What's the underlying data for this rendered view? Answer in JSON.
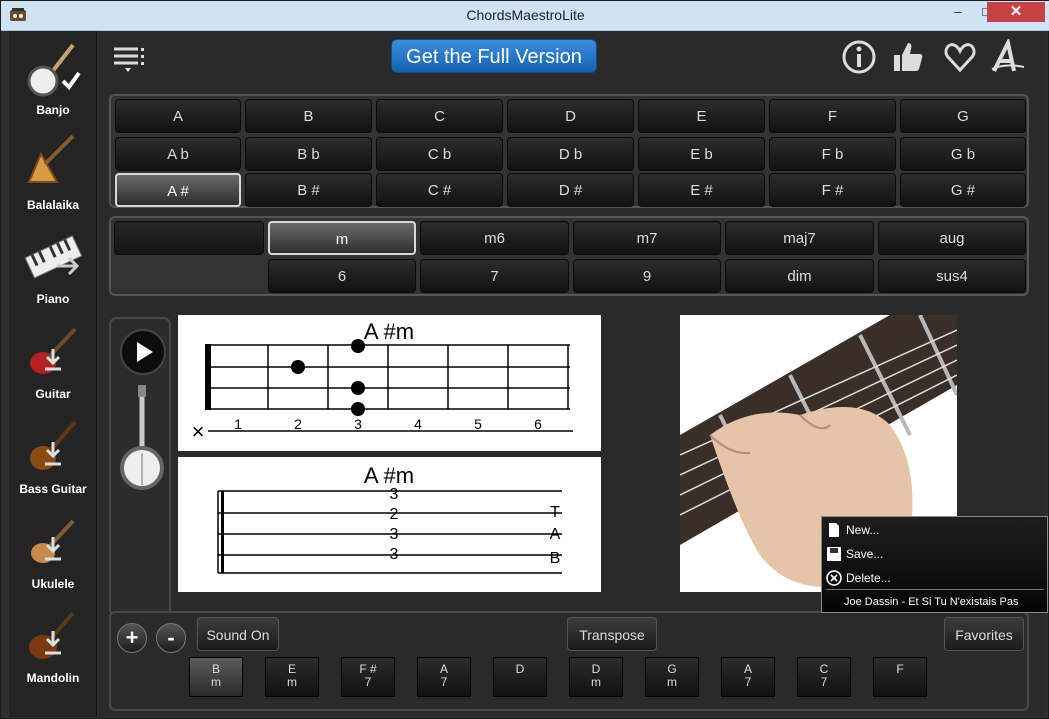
{
  "window": {
    "title": "ChordsMaestroLite"
  },
  "sidebar": {
    "items": [
      {
        "label": "Banjo"
      },
      {
        "label": "Balalaika"
      },
      {
        "label": "Piano"
      },
      {
        "label": "Guitar"
      },
      {
        "label": "Bass Guitar"
      },
      {
        "label": "Ukulele"
      },
      {
        "label": "Mandolin"
      }
    ]
  },
  "header": {
    "full_version": "Get the Full Version"
  },
  "keys": {
    "rows": [
      [
        "A",
        "B",
        "C",
        "D",
        "E",
        "F",
        "G"
      ],
      [
        "A b",
        "B b",
        "C b",
        "D b",
        "E b",
        "F b",
        "G b"
      ],
      [
        "A #",
        "B #",
        "C #",
        "D #",
        "E #",
        "F #",
        "G #"
      ]
    ],
    "selected": "A #"
  },
  "types": {
    "row1": [
      "",
      "m",
      "m6",
      "m7",
      "maj7",
      "aug"
    ],
    "row2": [
      "6",
      "7",
      "9",
      "dim",
      "sus4"
    ],
    "selected": "m"
  },
  "diagram": {
    "chord_name": "A #m",
    "mute": "×",
    "frets": [
      "1",
      "2",
      "3",
      "4",
      "5",
      "6"
    ],
    "dots": [
      {
        "string": 1,
        "fret": 3
      },
      {
        "string": 2,
        "fret": 2
      },
      {
        "string": 3,
        "fret": 3
      },
      {
        "string": 4,
        "fret": 3
      }
    ],
    "tab_numbers": [
      "3",
      "2",
      "3",
      "3"
    ],
    "tab_letters": [
      "T",
      "A",
      "B"
    ]
  },
  "bottom": {
    "sound": "Sound On",
    "transpose": "Transpose",
    "favorites": "Favorites",
    "plus": "+",
    "minus": "-",
    "progression": [
      {
        "n": "B",
        "q": "m"
      },
      {
        "n": "E",
        "q": "m"
      },
      {
        "n": "F #",
        "q": "7"
      },
      {
        "n": "A",
        "q": "7"
      },
      {
        "n": "D",
        "q": ""
      },
      {
        "n": "D",
        "q": "m"
      },
      {
        "n": "G",
        "q": "m"
      },
      {
        "n": "A",
        "q": "7"
      },
      {
        "n": "C",
        "q": "7"
      },
      {
        "n": "F",
        "q": ""
      }
    ],
    "selected_index": 0
  },
  "context_menu": {
    "items": [
      "New...",
      "Save...",
      "Delete..."
    ],
    "song": "Joe Dassin - Et Si Tu N'existais Pas"
  },
  "colors": {
    "accent": "#1f6fc0",
    "titlebar": "#cfe3f5",
    "close": "#c74343"
  }
}
